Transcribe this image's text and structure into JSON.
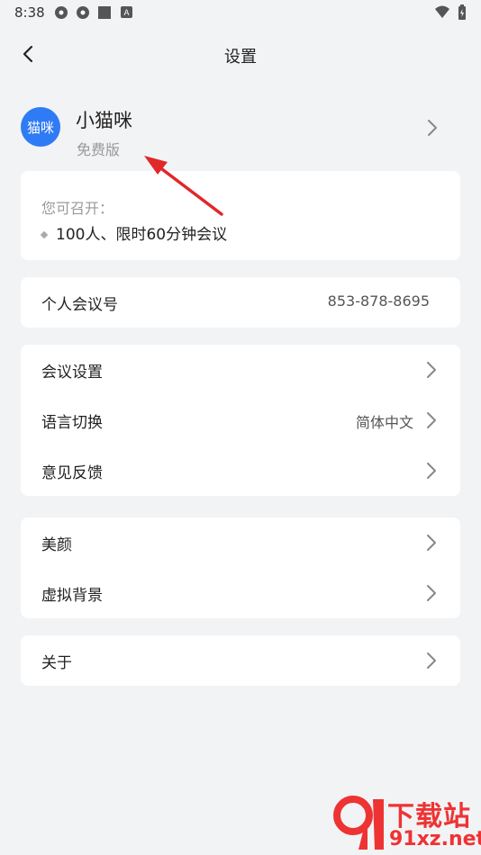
{
  "status_bar": {
    "time": "8:38"
  },
  "header": {
    "title": "设置"
  },
  "profile": {
    "avatar_text": "猫咪",
    "name": "小猫咪",
    "plan": "免费版"
  },
  "capability": {
    "title": "您可召开：",
    "item": "100人、限时60分钟会议"
  },
  "meeting_id": {
    "label": "个人会议号",
    "value": "853-878-8695"
  },
  "settings_group": [
    {
      "label": "会议设置",
      "value": ""
    },
    {
      "label": "语言切换",
      "value": "简体中文"
    },
    {
      "label": "意见反馈",
      "value": ""
    }
  ],
  "effects_group": [
    {
      "label": "美颜"
    },
    {
      "label": "虚拟背景"
    }
  ],
  "about": {
    "label": "关于"
  },
  "watermark": {
    "brand": "下载站",
    "domain": "91xz.net"
  },
  "colors": {
    "accent": "#2f7bf5",
    "annotation_arrow": "#e0282a",
    "background": "#f2f3f5"
  }
}
